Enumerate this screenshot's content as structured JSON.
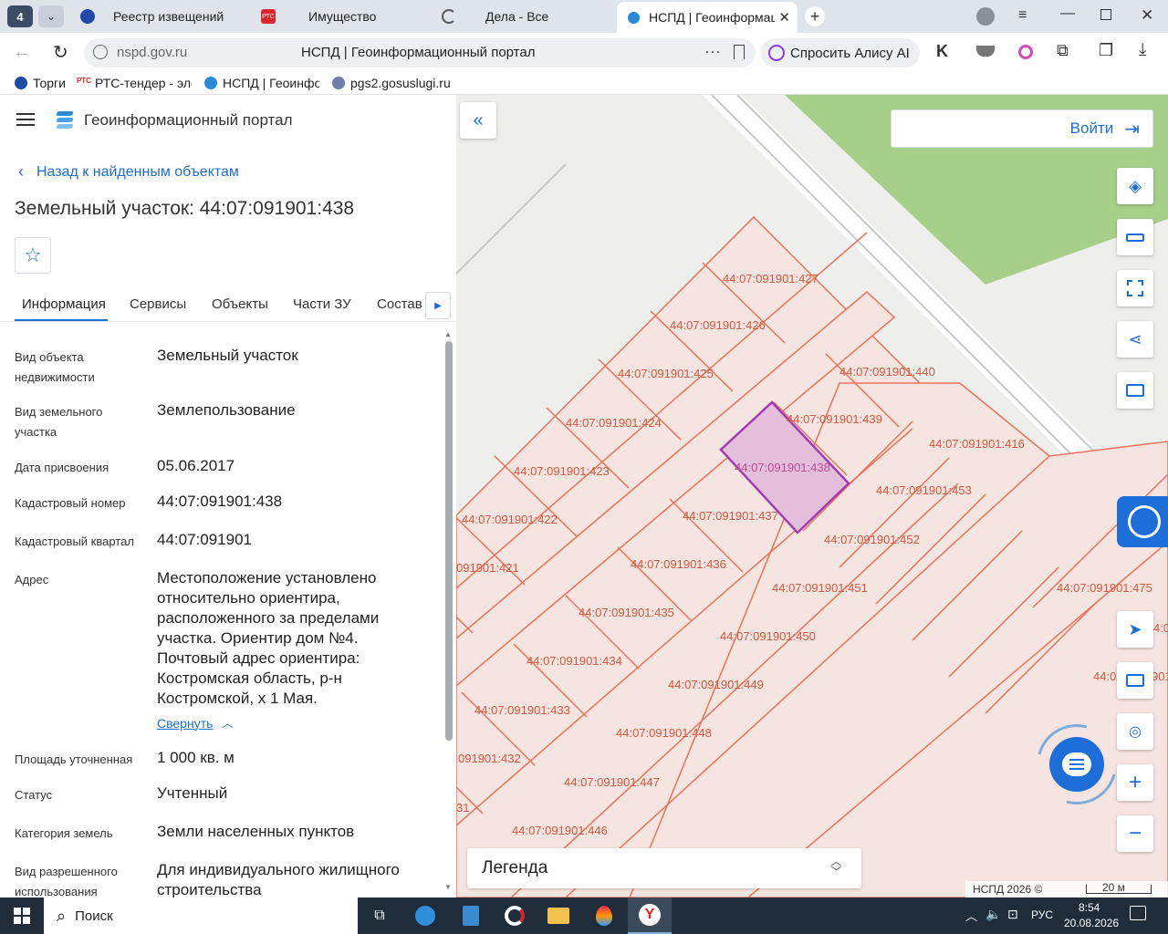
{
  "browser": {
    "tab_count_badge": "4",
    "tabs": [
      {
        "title": "Реестр извещений"
      },
      {
        "title": "Имущество"
      },
      {
        "title": "Дела - Все"
      },
      {
        "title": "НСПД | Геоинформаци"
      }
    ],
    "url": "nspd.gov.ru",
    "page_title": "НСПД | Геоинформационный портал",
    "alice_label": "Спросить Алису AI",
    "bookmarks": [
      {
        "label": "Торги"
      },
      {
        "label": "РТС-тендер - элек"
      },
      {
        "label": "НСПД | Геоинфор"
      },
      {
        "label": "pgs2.gosuslugi.ru"
      }
    ]
  },
  "panel": {
    "app_title": "Геоинформационный портал",
    "back_link": "Назад к найденным объектам",
    "object_title": "Земельный участок: 44:07:091901:438",
    "tabs": [
      "Информация",
      "Сервисы",
      "Объекты",
      "Части ЗУ",
      "Состав"
    ],
    "fields": [
      {
        "label": "Вид объекта недвижимости",
        "value": "Земельный участок"
      },
      {
        "label": "Вид земельного участка",
        "value": "Землепользование"
      },
      {
        "label": "Дата присвоения",
        "value": "05.06.2017"
      },
      {
        "label": "Кадастровый номер",
        "value": "44:07:091901:438"
      },
      {
        "label": "Кадастровый квартал",
        "value": "44:07:091901"
      },
      {
        "label": "Адрес",
        "value": "Местоположение установлено относительно ориентира, расположенного за пределами участка. Ориентир дом №4. Почтовый адрес ориентира: Костромская область, р-н Костромской, х 1 Мая."
      },
      {
        "label": "Площадь уточненная",
        "value": "1 000 кв. м"
      },
      {
        "label": "Статус",
        "value": "Учтенный"
      },
      {
        "label": "Категория земель",
        "value": "Земли населенных пунктов"
      },
      {
        "label": "Вид разрешенного использования",
        "value": "Для индивидуального жилищного строительства"
      }
    ],
    "collapse_link": "Свернуть"
  },
  "map": {
    "login_label": "Войти",
    "legend_label": "Легенда",
    "copyright": "НСПД 2026 ©",
    "scale_label": "20 м",
    "selected_parcel": "44:07:091901:438",
    "parcels": [
      "44:07:091901:427",
      "44:07:091901:426",
      "44:07:091901:425",
      "44:07:091901:424",
      "44:07:091901:423",
      "44:07:091901:422",
      "091901:421",
      "44:07:091901:440",
      "44:07:091901:439",
      "44:07:091901:416",
      "44:07:091901:438",
      "44:07:091901:453",
      "44:07:091901:437",
      "44:07:091901:452",
      "44:07:091901:436",
      "44:07:091901:451",
      "44:07:091901:435",
      "44:07:091901:450",
      "44:07:091901:434",
      "44:07:091901:449",
      "44:07:091901:433",
      "44:07:091901:448",
      "091901:432",
      "44:07:091901:447",
      "44:07:091901:446",
      "44:07:091901:475",
      "31",
      "44:07:0",
      "901",
      "4:0",
      "0"
    ],
    "colors": {
      "parcel_line": "#e8735a",
      "parcel_fill": "#f6e4e0",
      "selected_line": "#a23cb5",
      "selected_fill": "#e3bfdc",
      "park": "#a6cf8a"
    }
  },
  "taskbar": {
    "search_label": "Поиск",
    "lang": "РУС",
    "time": "8:54",
    "date": "20.08.2026"
  }
}
